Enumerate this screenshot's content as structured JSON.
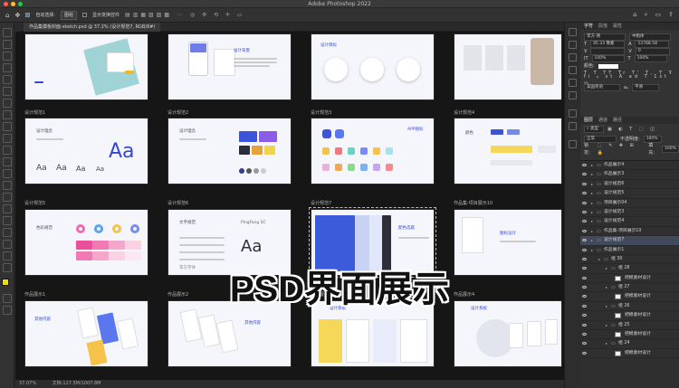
{
  "app": {
    "title": "Adobe Photoshop 2022",
    "colors": {
      "close": "#ff5f57",
      "min": "#febc2e",
      "max": "#28c840",
      "accent": "#3348cc"
    }
  },
  "options": {
    "auto_select": "自动选择:",
    "auto_select_value": "图组",
    "show_transform": "显示变换控件"
  },
  "document": {
    "tab": "作品集模板封面-sketch.psd @ 37.2% (设计规范7, RGB/8#)"
  },
  "status": {
    "zoom": "37.07%",
    "doc_size": "文档:127.5M/1007.8M"
  },
  "overlay_text": "PSD界面展示",
  "artboards": [
    {
      "label": "",
      "title": ""
    },
    {
      "label": "",
      "title": ""
    },
    {
      "label": "",
      "title": "设计背景"
    },
    {
      "label": "",
      "title": "设计目标"
    },
    {
      "label": "",
      "title": ""
    },
    {
      "label": "设计规范1",
      "title": "设计理念"
    },
    {
      "label": "设计规范2",
      "title": "设计理念"
    },
    {
      "label": "设计规范3",
      "title": ""
    },
    {
      "label": "设计规范4",
      "title": "颜色"
    },
    {
      "label": "设计规范5",
      "title": "色彩规范"
    },
    {
      "label": "设计规范6",
      "title": "文字规范"
    },
    {
      "label": "设计规范7",
      "title": "配色选取"
    },
    {
      "label": "作品集-项目展示10",
      "title": "图标设计"
    },
    {
      "label": "作品展示1",
      "title": "其他内容"
    },
    {
      "label": "作品展示2",
      "title": "其他内容"
    },
    {
      "label": "作品展示3",
      "title": "设计系统"
    },
    {
      "label": "作品展示4",
      "title": "设计系统"
    }
  ],
  "art_text": {
    "aa": "Aa",
    "app_label": "APP图标",
    "font_name": "PingFang SC",
    "font_sample": "苹方字体"
  },
  "panel": {
    "top_tabs": [
      "字符",
      "段落",
      "属性"
    ],
    "font_family": "苹方-简",
    "font_style": "中粗体",
    "font_size": "45.33 像素",
    "leading": "12768.58",
    "tracking": "0",
    "scale_v": "100%",
    "scale_h": "100%",
    "color_label": "颜色:",
    "lang": "美国英语",
    "aa_mode": "平滑",
    "layer_tabs": [
      "图层",
      "通道",
      "路径"
    ],
    "blend": "正常",
    "opacity_label": "不透明度:",
    "opacity": "100%",
    "lock_label": "锁定:",
    "fill_label": "填充:",
    "fill": "100%"
  },
  "layers": [
    {
      "name": "作品展示4",
      "indent": 0,
      "thumb": false
    },
    {
      "name": "作品展示3",
      "indent": 0,
      "thumb": false
    },
    {
      "name": "设计规范6",
      "indent": 0,
      "thumb": false
    },
    {
      "name": "设计规范5",
      "indent": 0,
      "thumb": false
    },
    {
      "name": "项目展示04",
      "indent": 0,
      "thumb": false
    },
    {
      "name": "设计规范3",
      "indent": 0,
      "thumb": false
    },
    {
      "name": "设计规范4",
      "indent": 0,
      "thumb": false
    },
    {
      "name": "作品集-项目展示10",
      "indent": 0,
      "thumb": false
    },
    {
      "name": "设计规范7",
      "indent": 0,
      "thumb": false,
      "selected": true
    },
    {
      "name": "作品展示1",
      "indent": 0,
      "thumb": false
    },
    {
      "name": "组 30",
      "indent": 1,
      "thumb": false
    },
    {
      "name": "组 28",
      "indent": 2,
      "thumb": false
    },
    {
      "name": "把模素材设计",
      "indent": 3,
      "thumb": true
    },
    {
      "name": "组 27",
      "indent": 2,
      "thumb": false
    },
    {
      "name": "把模素材设计",
      "indent": 3,
      "thumb": true
    },
    {
      "name": "组 26",
      "indent": 2,
      "thumb": false
    },
    {
      "name": "把模素材设计",
      "indent": 3,
      "thumb": true
    },
    {
      "name": "组 25",
      "indent": 2,
      "thumb": false
    },
    {
      "name": "把模素材设计",
      "indent": 3,
      "thumb": true
    },
    {
      "name": "组 24",
      "indent": 2,
      "thumb": false
    },
    {
      "name": "把模素材设计",
      "indent": 3,
      "thumb": true
    }
  ]
}
